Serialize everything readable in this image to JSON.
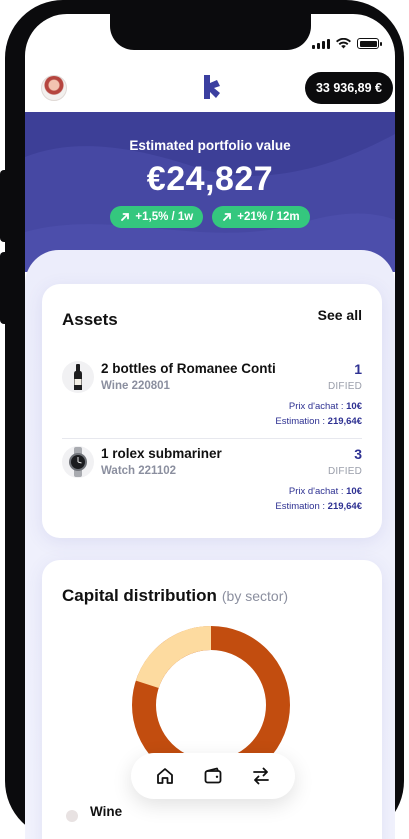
{
  "topbar": {
    "balance": "33 936,89 €"
  },
  "hero": {
    "title": "Estimated portfolio value",
    "value": "€24,827",
    "chips": [
      {
        "label": "+1,5% / 1w",
        "icon": "arrow-up-right-icon"
      },
      {
        "label": "+21% / 12m",
        "icon": "arrow-up-right-icon"
      }
    ]
  },
  "assets": {
    "title": "Assets",
    "see_all": "See all",
    "items": [
      {
        "name": "2 bottles of Romanee Conti",
        "sub": "Wine 220801",
        "qty": "1",
        "unit": "DIFIED",
        "purchase_label": "Prix d'achat : ",
        "purchase_value": "10€",
        "estimate_label": "Estimation : ",
        "estimate_value": "219,64€",
        "icon": "wine-bottle-icon"
      },
      {
        "name": "1 rolex submariner",
        "sub": "Watch 221102",
        "qty": "3",
        "unit": "DIFIED",
        "purchase_label": "Prix d'achat : ",
        "purchase_value": "10€",
        "estimate_label": "Estimation : ",
        "estimate_value": "219,64€",
        "icon": "watch-icon"
      }
    ]
  },
  "distribution": {
    "title": "Capital distribution",
    "subtitle": "(by sector)",
    "legend_first": "Wine",
    "colors": {
      "primary": "#c24d0f",
      "secondary": "#fddba0"
    }
  },
  "nav": {
    "items": [
      "home-icon",
      "wallet-icon",
      "transfer-arrows-icon"
    ]
  },
  "colors": {
    "brand": "#4648a3",
    "accent_green": "#34c77e",
    "text_blue": "#2e3192"
  }
}
